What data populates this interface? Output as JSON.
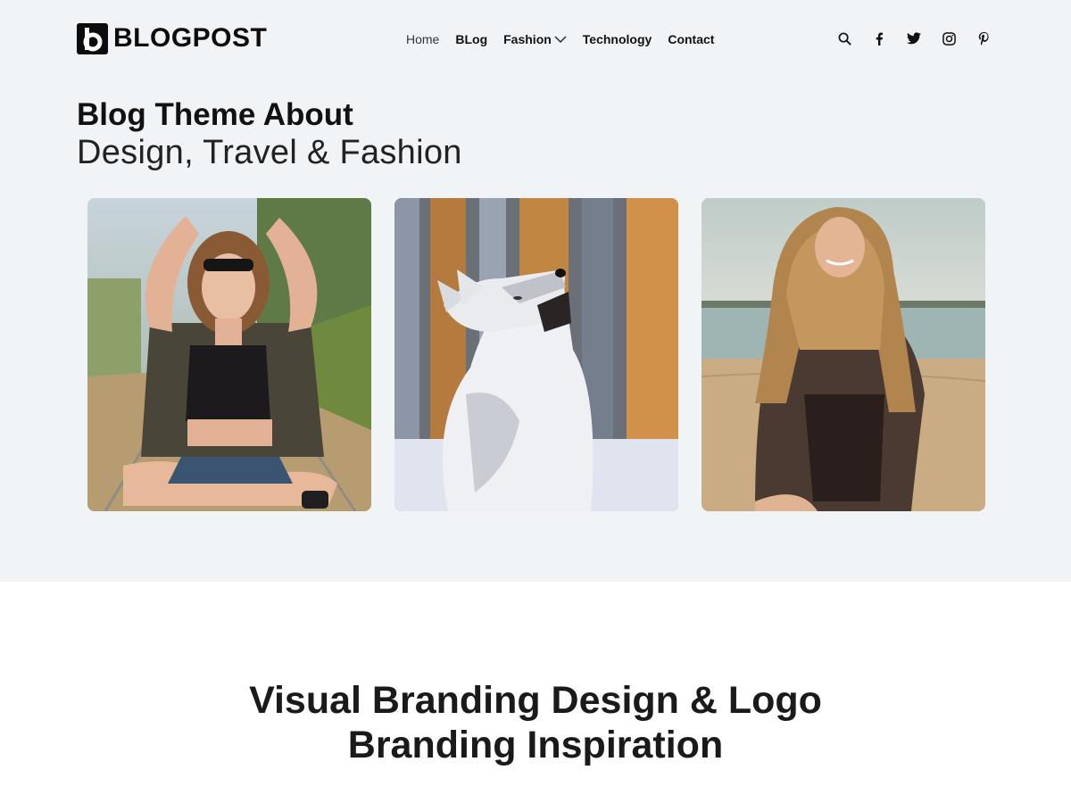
{
  "brand": {
    "name": "BLOGPOST",
    "logo_letter": "b"
  },
  "nav": {
    "items": [
      {
        "label": "Home"
      },
      {
        "label": "BLog"
      },
      {
        "label": "Fashion",
        "has_dropdown": true
      },
      {
        "label": "Technology"
      },
      {
        "label": "Contact"
      }
    ]
  },
  "social": {
    "icons": [
      "search-icon",
      "facebook-icon",
      "twitter-icon",
      "instagram-icon",
      "pinterest-icon"
    ]
  },
  "hero": {
    "title_line1": "Blog Theme About",
    "title_line2": "Design, Travel & Fashion",
    "cards": [
      {
        "subject": "woman-sitting-sunglasses"
      },
      {
        "subject": "howling-husky"
      },
      {
        "subject": "woman-on-beach"
      }
    ]
  },
  "section": {
    "title_line1": "Visual Branding Design & Logo",
    "title_line2": "Branding Inspiration"
  },
  "colors": {
    "hero_bg": "#f1f4f7",
    "text": "#111111",
    "page_bg": "#ffffff"
  }
}
